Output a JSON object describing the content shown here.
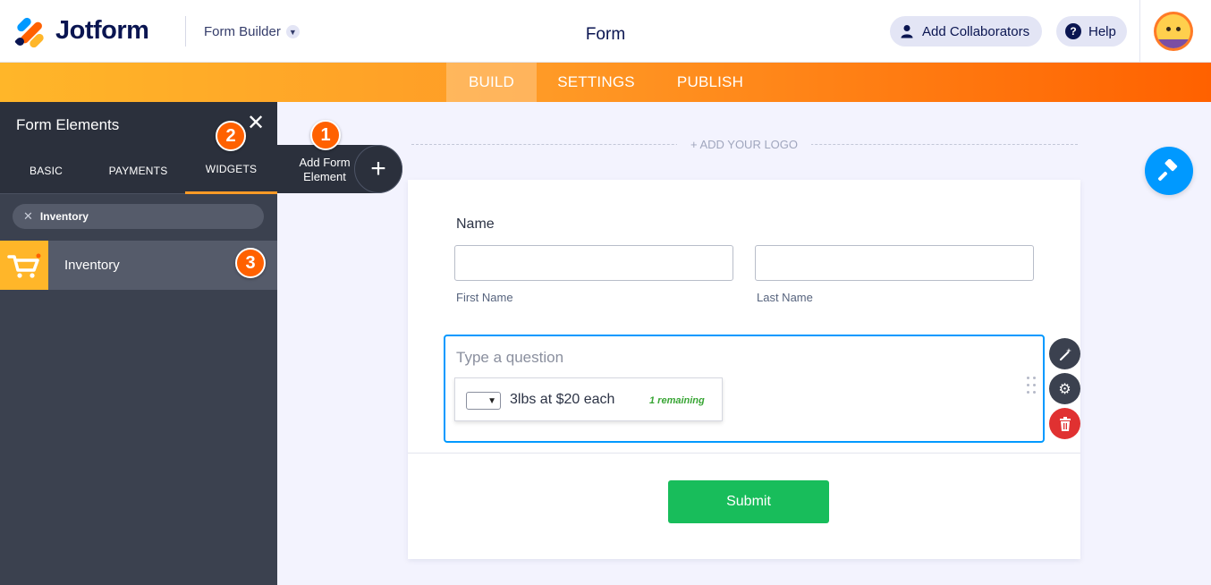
{
  "header": {
    "brand": "Jotform",
    "builder_label": "Form Builder",
    "form_title": "Form",
    "collaborators_label": "Add Collaborators",
    "help_label": "Help",
    "icons": {
      "chevron": "chevron-down-icon",
      "collab": "user-icon",
      "help": "question-icon"
    }
  },
  "nav": {
    "tabs": [
      "BUILD",
      "SETTINGS",
      "PUBLISH"
    ],
    "active": "BUILD"
  },
  "panel": {
    "title": "Form Elements",
    "tabs": [
      "BASIC",
      "PAYMENTS",
      "WIDGETS"
    ],
    "active_tab": "WIDGETS",
    "search_value": "Inventory",
    "results": [
      {
        "label": "Inventory",
        "icon": "shopping-cart-icon"
      }
    ]
  },
  "badges": [
    "1",
    "2",
    "3"
  ],
  "add_element": {
    "label": "Add Form Element"
  },
  "canvas": {
    "add_logo": "+ ADD YOUR LOGO",
    "name_label": "Name",
    "first_sublabel": "First Name",
    "last_sublabel": "Last Name",
    "question_placeholder": "Type a question",
    "inventory_item": "3lbs at $20 each",
    "inventory_remaining": "1 remaining",
    "submit_label": "Submit"
  },
  "colors": {
    "accent_orange": "#ff6100",
    "accent_blue": "#0099ff",
    "submit_green": "#18bd5b",
    "delete_red": "#e03131",
    "panel_dark": "#3b414f"
  }
}
